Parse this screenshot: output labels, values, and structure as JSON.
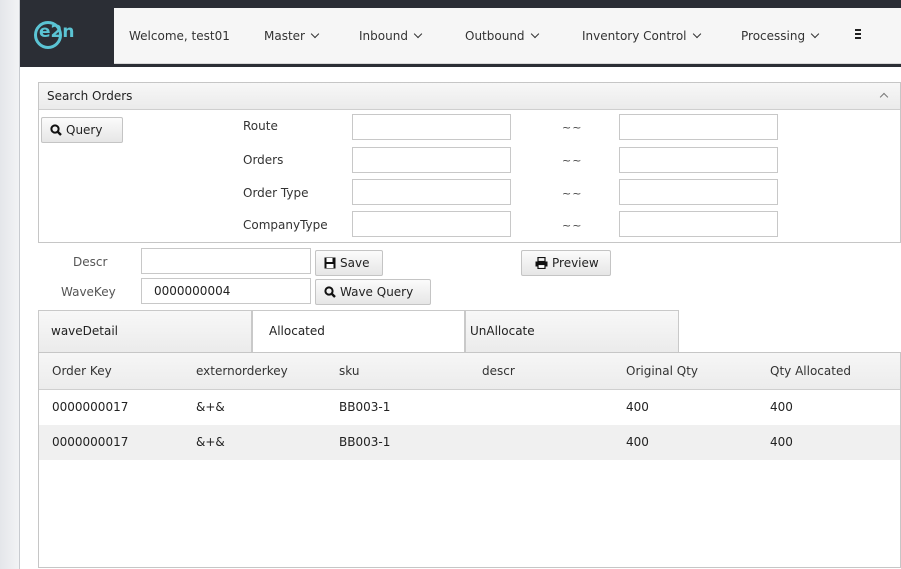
{
  "header": {
    "logo_text": "e2n",
    "welcome": "Welcome, test01",
    "menu": [
      {
        "label": "Master"
      },
      {
        "label": "Inbound"
      },
      {
        "label": "Outbound"
      },
      {
        "label": "Inventory Control"
      },
      {
        "label": "Processing"
      }
    ],
    "menu_icon": "hamburger-icon"
  },
  "search_panel": {
    "title": "Search Orders",
    "query_button": "Query",
    "fields": [
      {
        "label": "Route",
        "from": "",
        "separator": "~~",
        "to": ""
      },
      {
        "label": "Orders",
        "from": "",
        "separator": "~~",
        "to": ""
      },
      {
        "label": "Order Type",
        "from": "",
        "separator": "~~",
        "to": ""
      },
      {
        "label": "CompanyType",
        "from": "",
        "separator": "~~",
        "to": ""
      }
    ]
  },
  "wave": {
    "descr_label": "Descr",
    "descr_value": "",
    "wavekey_label": "WaveKey",
    "wavekey_value": "0000000004",
    "save_button": "Save",
    "preview_button": "Preview",
    "wave_query_button": "Wave Query"
  },
  "tabs": [
    {
      "label": "waveDetail",
      "active": false
    },
    {
      "label": "Allocated",
      "active": true
    },
    {
      "label": "UnAllocate",
      "active": false
    }
  ],
  "table": {
    "columns": [
      "Order Key",
      "externorderkey",
      "sku",
      "descr",
      "Original Qty",
      "Qty Allocated"
    ],
    "rows": [
      [
        "0000000017",
        "&+&",
        "BB003-1",
        "",
        "400",
        "400"
      ],
      [
        "0000000017",
        "&+&",
        "BB003-1",
        "",
        "400",
        "400"
      ]
    ]
  },
  "colors": {
    "topbar": "#2b2e35",
    "logo_accent": "#5bc4d4",
    "navbar": "#f6f6f6",
    "row_alt": "#f0f0f0"
  }
}
